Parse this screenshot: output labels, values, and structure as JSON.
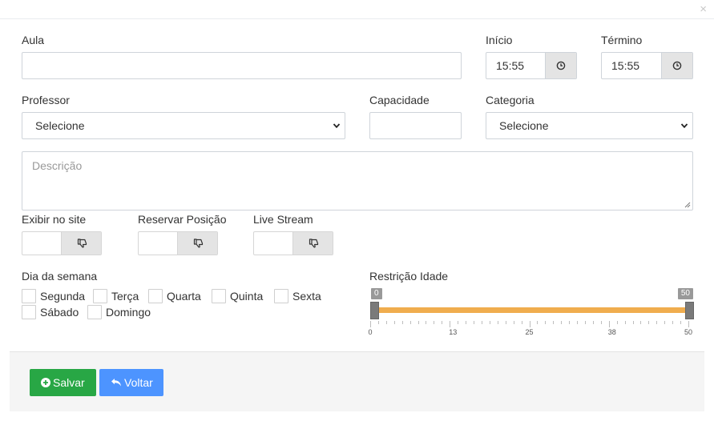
{
  "modal": {
    "close_glyph": "×"
  },
  "form": {
    "aula": {
      "label": "Aula",
      "value": ""
    },
    "inicio": {
      "label": "Início",
      "value": "15:55",
      "icon": "clock-icon"
    },
    "termino": {
      "label": "Término",
      "value": "15:55",
      "icon": "clock-icon"
    },
    "professor": {
      "label": "Professor",
      "selected": "Selecione"
    },
    "capacidade": {
      "label": "Capacidade",
      "value": ""
    },
    "categoria": {
      "label": "Categoria",
      "selected": "Selecione"
    },
    "descricao": {
      "placeholder": "Descrição"
    },
    "toggles": [
      {
        "label": "Exibir no site",
        "state": "off",
        "icon": "thumbs-down-icon"
      },
      {
        "label": "Reservar Posição",
        "state": "off",
        "icon": "thumbs-down-icon"
      },
      {
        "label": "Live Stream",
        "state": "off",
        "icon": "thumbs-down-icon"
      }
    ],
    "dia_semana": {
      "label": "Dia da semana",
      "days": [
        {
          "label": "Segunda",
          "checked": false
        },
        {
          "label": "Terça",
          "checked": false
        },
        {
          "label": "Quarta",
          "checked": false
        },
        {
          "label": "Quinta",
          "checked": false
        },
        {
          "label": "Sexta",
          "checked": false
        },
        {
          "label": "Sábado",
          "checked": false
        },
        {
          "label": "Domingo",
          "checked": false
        }
      ]
    },
    "restricao_idade": {
      "label": "Restrição Idade",
      "min": 0,
      "max": 50,
      "from": 0,
      "to": 50,
      "from_label": "0",
      "to_label": "50",
      "tick_labels": [
        "0",
        "13",
        "25",
        "38",
        "50"
      ],
      "colors": {
        "bar": "#f0ad4e",
        "handle": "#7a7a7a"
      }
    }
  },
  "footer": {
    "save_label": "Salvar",
    "save_icon": "plus-circle-icon",
    "back_label": "Voltar",
    "back_icon": "undo-arrow-icon"
  },
  "colors": {
    "save": "#28a745",
    "back": "#4d94ff",
    "footer_bg": "#f5f5f5"
  }
}
